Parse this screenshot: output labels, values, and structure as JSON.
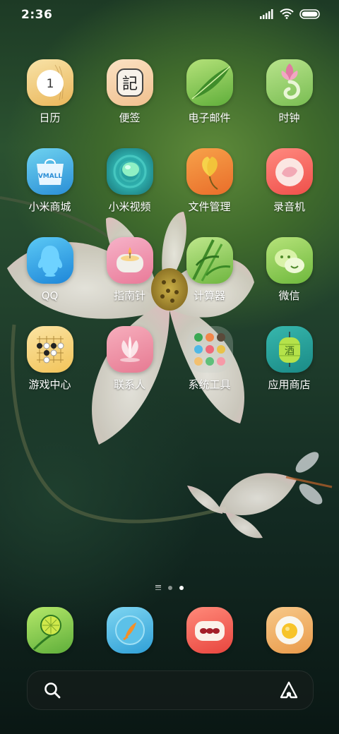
{
  "status_bar": {
    "time": "2:36",
    "icons": [
      "signal-icon",
      "wifi-icon",
      "battery-icon"
    ]
  },
  "apps": [
    {
      "label": "日历",
      "icon": "calendar-icon",
      "badge": "1"
    },
    {
      "label": "便签",
      "icon": "notes-icon",
      "glyph": "記"
    },
    {
      "label": "电子邮件",
      "icon": "email-icon"
    },
    {
      "label": "时钟",
      "icon": "clock-icon"
    },
    {
      "label": "小米商城",
      "icon": "mi-store-icon",
      "glyph": "VMALL"
    },
    {
      "label": "小米视频",
      "icon": "mi-video-icon"
    },
    {
      "label": "文件管理",
      "icon": "file-manager-icon"
    },
    {
      "label": "录音机",
      "icon": "recorder-icon"
    },
    {
      "label": "QQ",
      "icon": "qq-icon"
    },
    {
      "label": "指南针",
      "icon": "compass-icon"
    },
    {
      "label": "计算器",
      "icon": "calculator-icon"
    },
    {
      "label": "微信",
      "icon": "wechat-icon"
    },
    {
      "label": "游戏中心",
      "icon": "game-center-icon"
    },
    {
      "label": "联系人",
      "icon": "contacts-icon"
    },
    {
      "label": "系统工具",
      "icon": "system-tools-folder-icon"
    },
    {
      "label": "应用商店",
      "icon": "app-store-icon",
      "glyph": "酒"
    }
  ],
  "page_indicator": {
    "pages": 3,
    "active": 2
  },
  "dock": [
    {
      "icon": "phone-icon"
    },
    {
      "icon": "messages-icon"
    },
    {
      "icon": "browser-icon"
    },
    {
      "icon": "camera-icon"
    }
  ],
  "colors": {
    "accent": "#ffffff",
    "search_bar": "#141c1a"
  }
}
